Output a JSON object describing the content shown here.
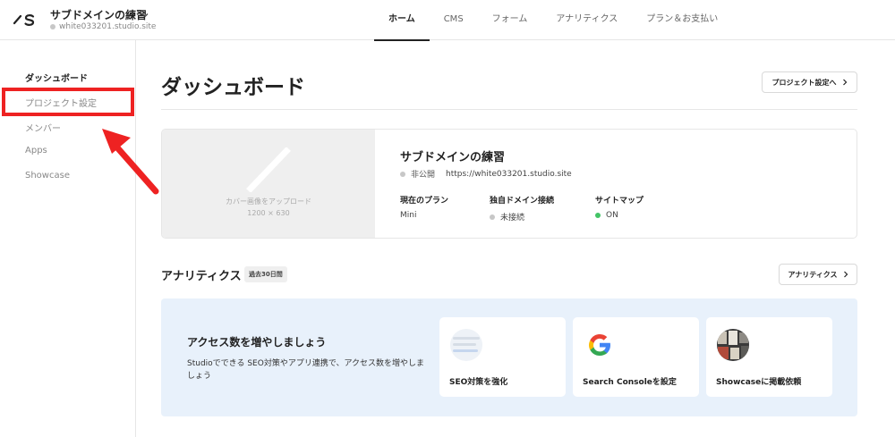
{
  "header": {
    "project_name": "サブドメインの練習",
    "project_url": "white033201.studio.site",
    "nav": [
      {
        "label": "ホーム",
        "active": true
      },
      {
        "label": "CMS",
        "active": false
      },
      {
        "label": "フォーム",
        "active": false
      },
      {
        "label": "アナリティクス",
        "active": false
      },
      {
        "label": "プラン＆お支払い",
        "active": false
      }
    ]
  },
  "sidebar": {
    "items": [
      {
        "label": "ダッシュボード",
        "active": true
      },
      {
        "label": "プロジェクト設定",
        "active": false
      },
      {
        "label": "メンバー",
        "active": false
      },
      {
        "label": "Apps",
        "active": false
      },
      {
        "label": "Showcase",
        "active": false
      }
    ]
  },
  "main": {
    "title": "ダッシュボード",
    "project_settings_button": "プロジェクト設定へ",
    "project_card": {
      "cover_upload_text": "カバー画像をアップロード",
      "cover_size": "1200 × 630",
      "name": "サブドメインの練習",
      "status": "非公開",
      "url": "https://white033201.studio.site",
      "current_plan_label": "現在のプラン",
      "current_plan_value": "Mini",
      "custom_domain_label": "独自ドメイン接続",
      "custom_domain_value": "未接続",
      "sitemap_label": "サイトマップ",
      "sitemap_value": "ON"
    },
    "analytics": {
      "title": "アナリティクス",
      "period_badge": "過去30日間",
      "button": "アナリティクス"
    },
    "promo": {
      "title": "アクセス数を増やしましょう",
      "description": "Studioでできる SEO対策やアプリ連携で、アクセス数を増やしましょう",
      "cards": [
        {
          "label": "SEO対策を強化",
          "icon": "seo-thumbnail"
        },
        {
          "label": "Search Consoleを設定",
          "icon": "google-icon"
        },
        {
          "label": "Showcaseに掲載依頼",
          "icon": "showcase-thumbnail"
        }
      ]
    }
  },
  "colors": {
    "annotation_red": "#ee2222",
    "promo_bg": "#e8f1fb",
    "status_green": "#43c466"
  }
}
